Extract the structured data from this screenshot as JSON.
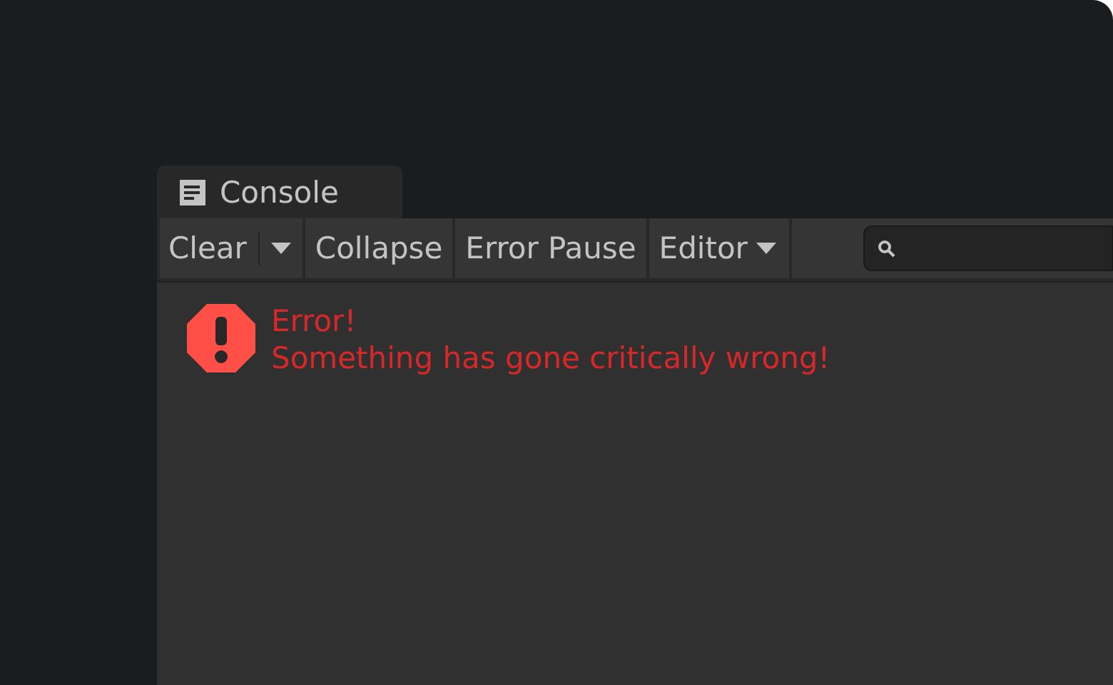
{
  "tab": {
    "title": "Console",
    "selected": true
  },
  "toolbar": [
    {
      "kind": "split",
      "label": "Clear"
    },
    {
      "kind": "toggle",
      "label": "Collapse",
      "on": false
    },
    {
      "kind": "toggle",
      "label": "Error Pause",
      "on": false
    },
    {
      "kind": "dropdown",
      "label": "Editor"
    }
  ],
  "log": [
    {
      "kind": "error",
      "lines": [
        "Error!",
        "Something has gone critically wrong!"
      ]
    }
  ]
}
